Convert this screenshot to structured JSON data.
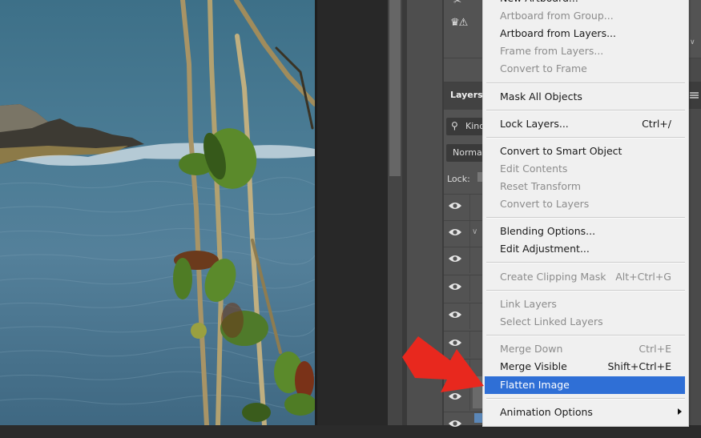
{
  "canvas": {
    "description": "Photo of sea with rocky shore and plant stems in foreground"
  },
  "panel": {
    "layers_tab_label": "Layers",
    "filter_kind_label": "Kind",
    "blend_mode_value": "Normal",
    "lock_label": "Lock:",
    "warning_icon": "crown-warning-icon"
  },
  "context_menu": {
    "items": [
      {
        "label": "New Artboard...",
        "shortcut": "",
        "enabled": true
      },
      {
        "label": "Artboard from Group...",
        "shortcut": "",
        "enabled": false
      },
      {
        "label": "Artboard from Layers...",
        "shortcut": "",
        "enabled": true
      },
      {
        "label": "Frame from Layers...",
        "shortcut": "",
        "enabled": false
      },
      {
        "label": "Convert to Frame",
        "shortcut": "",
        "enabled": false
      },
      {
        "label": "Mask All Objects",
        "shortcut": "",
        "enabled": true
      },
      {
        "label": "Lock Layers...",
        "shortcut": "Ctrl+/",
        "enabled": true
      },
      {
        "label": "Convert to Smart Object",
        "shortcut": "",
        "enabled": true
      },
      {
        "label": "Edit Contents",
        "shortcut": "",
        "enabled": false
      },
      {
        "label": "Reset Transform",
        "shortcut": "",
        "enabled": false
      },
      {
        "label": "Convert to Layers",
        "shortcut": "",
        "enabled": false
      },
      {
        "label": "Blending Options...",
        "shortcut": "",
        "enabled": true
      },
      {
        "label": "Edit Adjustment...",
        "shortcut": "",
        "enabled": true
      },
      {
        "label": "Create Clipping Mask",
        "shortcut": "Alt+Ctrl+G",
        "enabled": false
      },
      {
        "label": "Link Layers",
        "shortcut": "",
        "enabled": false
      },
      {
        "label": "Select Linked Layers",
        "shortcut": "",
        "enabled": false
      },
      {
        "label": "Merge Down",
        "shortcut": "Ctrl+E",
        "enabled": false
      },
      {
        "label": "Merge Visible",
        "shortcut": "Shift+Ctrl+E",
        "enabled": true
      },
      {
        "label": "Flatten Image",
        "shortcut": "",
        "enabled": true,
        "highlighted": true
      },
      {
        "label": "Animation Options",
        "shortcut": "",
        "enabled": true,
        "submenu": true
      }
    ]
  },
  "colors": {
    "menu_highlight": "#2f6fd6",
    "annotation_arrow": "#e8281e"
  }
}
